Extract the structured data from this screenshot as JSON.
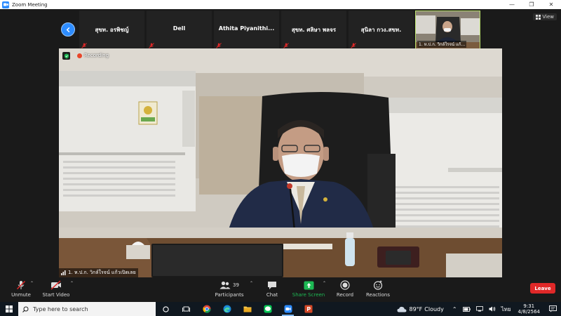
{
  "window": {
    "title": "Zoom Meeting"
  },
  "strip": {
    "tiles": [
      {
        "name": "สุขท. อรพิชญ์"
      },
      {
        "name": "Dell"
      },
      {
        "name": "Athita  Piyanithi..."
      },
      {
        "name": "สุขท. ศลิษา พลจร"
      },
      {
        "name": "สุนิลา กวง.สขท."
      }
    ],
    "video_tile_name": "1. ห.ป.ก. วิกล์ใรจน์ แก้...",
    "view_label": "View"
  },
  "main_video": {
    "recording_label": "Recording",
    "speaker_name": "1. ห.ป.ก. วิกล์ใรจน์ แก้วเปิดเลย"
  },
  "toolbar": {
    "unmute": "Unmute",
    "start_video": "Start Video",
    "participants": "Participants",
    "participants_count": "39",
    "chat": "Chat",
    "share_screen": "Share Screen",
    "record": "Record",
    "reactions": "Reactions",
    "leave": "Leave"
  },
  "taskbar": {
    "search_placeholder": "Type here to search",
    "weather_temp": "89°F",
    "weather_desc": "Cloudy",
    "lang": "ไทย",
    "time": "9:31",
    "date": "4/8/2564"
  },
  "colors": {
    "zoom_blue": "#2d8cff",
    "leave_red": "#e02828",
    "share_green": "#1db954",
    "mute_red": "#e02828"
  }
}
